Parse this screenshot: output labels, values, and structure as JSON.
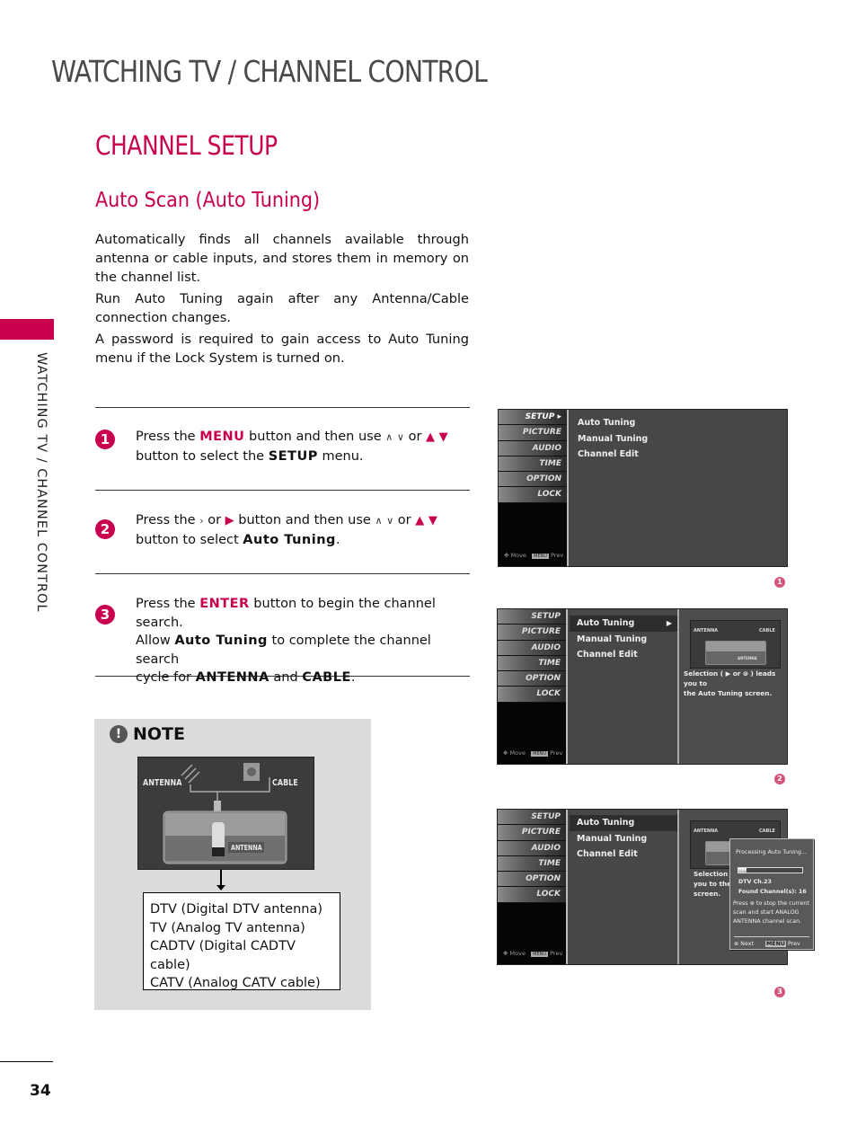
{
  "header": {
    "title": "WATCHING TV / CHANNEL CONTROL"
  },
  "section": {
    "title": "CHANNEL SETUP"
  },
  "subsection": {
    "title": "Auto Scan (Auto Tuning)"
  },
  "side_tab": {
    "label": "WATCHING TV / CHANNEL CONTROL",
    "color": "#c8004e"
  },
  "intro": [
    "Automatically finds all channels available through antenna or cable inputs, and stores them in memory on the channel list.",
    "Run Auto Tuning again after any Antenna/Cable connection changes.",
    "A password is required to gain access to Auto Tuning menu if the Lock System is turned on."
  ],
  "steps": [
    {
      "number": "1",
      "parts": {
        "a": "Press the ",
        "key": "MENU",
        "b": " button and then use ",
        "up": "∧",
        "down": "∨",
        "or": " or ",
        "tri_up": "▲",
        "tri_down": "▼",
        "c": "button to select the ",
        "target": "SETUP",
        "d": " menu."
      }
    },
    {
      "number": "2",
      "parts": {
        "a": "Press the ",
        "right": "›",
        "or1": " or ",
        "tri_right": "▶",
        "b": " button and then use ",
        "up": "∧",
        "down": "∨",
        "or": " or ",
        "tri_up": "▲",
        "tri_down": "▼",
        "c": "button to select ",
        "target": "Auto Tuning",
        "d": "."
      }
    },
    {
      "number": "3",
      "parts": {
        "a": "Press the ",
        "key": "ENTER",
        "b": " button to begin the channel search.",
        "c": "Allow ",
        "target": "Auto Tuning",
        "d": " to complete the channel search",
        "e": "cycle for ",
        "t1": "ANTENNA",
        "f": " and ",
        "t2": "CABLE",
        "g": "."
      }
    }
  ],
  "note": {
    "icon": "exclamation-icon",
    "label": "NOTE",
    "diagram": {
      "antenna": "ANTENNA",
      "cable": "CABLE",
      "port": "ANTENNA"
    },
    "types": [
      "DTV (Digital DTV antenna)",
      "TV (Analog TV antenna)",
      "CADTV (Digital CADTV cable)",
      "CATV (Analog CATV cable)"
    ]
  },
  "tv_menu": {
    "side_items": [
      "SETUP",
      "PICTURE",
      "AUDIO",
      "TIME",
      "OPTION",
      "LOCK"
    ],
    "footer_move": "Move",
    "footer_menu": "MENU",
    "footer_prev": "Prev",
    "items": [
      "Auto Tuning",
      "Manual Tuning",
      "Channel Edit"
    ],
    "arrow": "▶"
  },
  "screens": [
    {
      "figure": "1",
      "active_side": "SETUP"
    },
    {
      "figure": "2",
      "diagram": {
        "antenna": "ANTENNA",
        "cable": "CABLE",
        "port": "ANTENNA"
      },
      "selection_text_1": "Selection ( ▶ or ⊛ ) leads you to",
      "selection_text_2": "the Auto Tuning screen."
    },
    {
      "figure": "3",
      "diagram": {
        "antenna": "ANTENNA",
        "cable": "CABLE"
      },
      "selection_partial": [
        "Selection (",
        "you to the",
        "screen."
      ],
      "popup": {
        "title": "Processing Auto Tuning...",
        "progress": 0.12,
        "channel": "DTV Ch.23",
        "found": "Found Channel(s): 16",
        "instruction": [
          "Press ⊛ to stop the current",
          "scan and start ANALOG",
          "ANTENNA channel  scan."
        ],
        "next": "Next",
        "menu": "MENU",
        "prev": "Prev"
      }
    }
  ],
  "page_number": "34"
}
